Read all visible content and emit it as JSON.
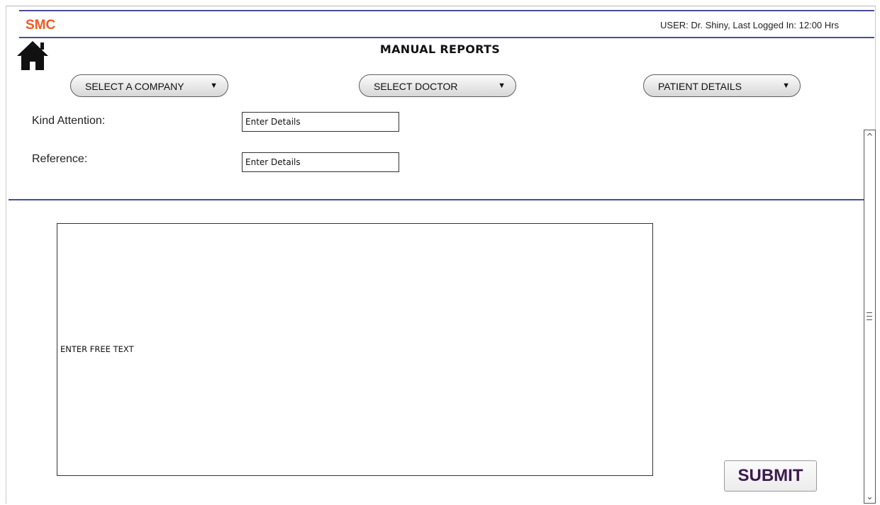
{
  "header": {
    "brand": "SMC",
    "user_info": "USER: Dr. Shiny, Last Logged In: 12:00 Hrs",
    "page_title": "MANUAL REPORTS"
  },
  "icons": {
    "home": "home-icon",
    "dropdown_arrow": "caret-down-icon",
    "scroll_up": "chevron-up-icon",
    "scroll_down": "chevron-down-icon"
  },
  "selectors": {
    "company": "SELECT A COMPANY",
    "doctor": "SELECT DOCTOR",
    "patient": "PATIENT DETAILS"
  },
  "form": {
    "kind_attention_label": "Kind Attention:",
    "kind_attention_placeholder": "Enter Details",
    "reference_label": "Reference:",
    "reference_placeholder": "Enter Details",
    "free_text_placeholder": "ENTER FREE TEXT",
    "submit_label": "SUBMIT"
  },
  "colors": {
    "brand": "#ef5b21",
    "rule": "#4a4e96",
    "submit_text": "#3c1a4d"
  }
}
